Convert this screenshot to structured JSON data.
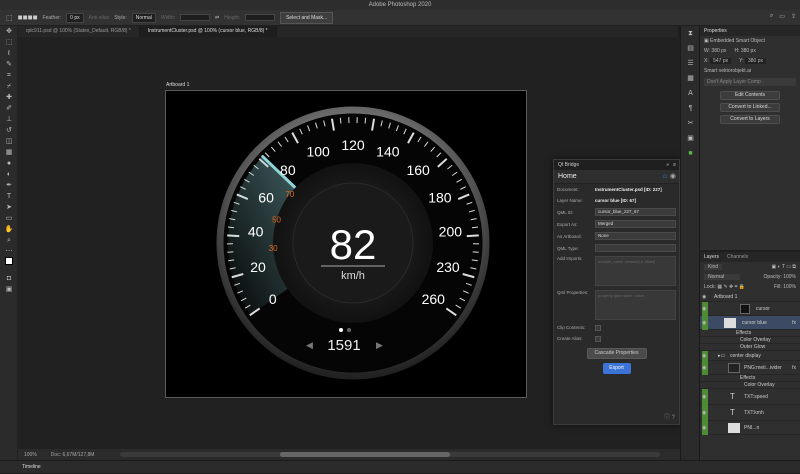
{
  "app": {
    "title": "Adobe Photoshop 2020"
  },
  "options_bar": {
    "feather_label": "Feather:",
    "feather_value": "0 px",
    "anti_alias_label": "Anti-alias",
    "style_label": "Style:",
    "style_value": "Normal",
    "width_label": "Width:",
    "height_label": "Height:",
    "select_mask_label": "Select and Mask..."
  },
  "tabs": [
    {
      "label": "qdc911.psd @ 100% (States_Default, RGB/8) *"
    },
    {
      "label": "InstrumentCluster.psd @ 100% (cursor blue, RGB/8) *"
    }
  ],
  "artboard": {
    "label": "Artboard 1"
  },
  "gauge": {
    "speed": 82,
    "unit": "km/h",
    "odometer": "1591",
    "speed_fraction": 0.315,
    "ticks_white": [
      "0",
      "20",
      "40",
      "60",
      "80",
      "100",
      "120",
      "140",
      "160",
      "180",
      "200",
      "230",
      "260"
    ],
    "ticks_orange": [
      "30",
      "50",
      "70"
    ],
    "colors": {
      "needle": "#8fd4d8",
      "orange": "#e06b1e"
    }
  },
  "qt_bridge": {
    "title": "Qt Bridge",
    "home": "Home",
    "document_label": "Document:",
    "document_value": "InstrumentCluster.psd [ID: 227]",
    "layer_name_label": "Layer Name:",
    "layer_name_value": "cursor blue [ID: 67]",
    "qml_id_label": "QML ID:",
    "qml_id_value": "cursor_blue_227_67",
    "export_as_label": "Export As:",
    "export_as_value": "Merged",
    "as_artboard_label": "As Artboard:",
    "as_artboard_value": "None",
    "qml_type_label": "QML Type:",
    "add_imports_label": "Add Imports:",
    "add_imports_placeholder": "module_name version(i.e.,Main)",
    "qml_properties_label": "Qml Properties:",
    "qml_properties_placeholder": "property type:name: value",
    "clip_contents_label": "Clip Contents:",
    "create_alias_label": "Create Alias:",
    "cascade_label": "Cascade Properties",
    "export_label": "Export"
  },
  "properties": {
    "tab": "Properties",
    "subtitle": "Embedded Smart Object",
    "w_label": "W:",
    "w_value": "380 px",
    "h_label": "H:",
    "h_value": "380 px",
    "x_label": "X:",
    "x_value": "547 px",
    "y_label": "Y:",
    "y_value": "380 px",
    "file": "Smart vektorobjekt.ai",
    "layer_comp": "Don't Apply Layer Comp",
    "edit_contents": "Edit Contents",
    "convert_linked": "Convert to Linked...",
    "convert_layers": "Convert to Layers"
  },
  "layers_panel": {
    "tab_layers": "Layers",
    "tab_channels": "Channels",
    "kind": "Kind",
    "blend": "Normal",
    "opacity_label": "Opacity:",
    "opacity_value": "100%",
    "lock_label": "Lock:",
    "fill_label": "Fill:",
    "fill_value": "100%",
    "rows": [
      {
        "name": "Artboard 1"
      },
      {
        "name": "cursor"
      },
      {
        "name": "cursor blue"
      },
      {
        "name": "Effects"
      },
      {
        "name": "Color Overlay"
      },
      {
        "name": "Outer Glow"
      },
      {
        "name": "center display"
      },
      {
        "name": "PNG:meti...ivider"
      },
      {
        "name": "Effects"
      },
      {
        "name": "Color Overlay"
      },
      {
        "name": "TXT:speed"
      },
      {
        "name": "TXT:kmh"
      },
      {
        "name": "PNI...n"
      }
    ]
  },
  "status": {
    "zoom": "100%",
    "doc": "Doc: 6,67M/127,8M"
  },
  "timeline": {
    "label": "Timeline"
  }
}
